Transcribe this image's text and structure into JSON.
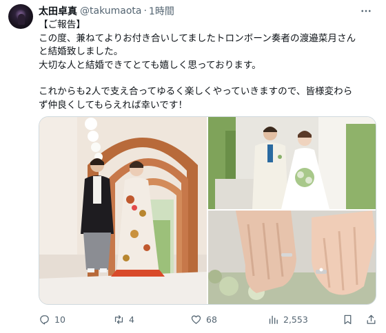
{
  "author": {
    "name": "太田卓真",
    "handle": "@takumaota",
    "separator": "·",
    "time": "1時間"
  },
  "tweet": {
    "lines": [
      "【ご報告】",
      "この度、兼ねてよりお付き合いしてましたトロンボーン奏者の渡邉菜月さん",
      "と結婚致しました。",
      "大切な人と結婚できてとても嬉しく思っております。",
      "",
      "これからも2人で支え合ってゆるく楽しくやっていきますので、皆様変わら",
      "ず仲良くしてもらえれば幸いです！"
    ]
  },
  "media": {
    "photos": [
      "couple-in-kimono-arch-corridor",
      "couple-in-western-wedding-attire",
      "hands-with-wedding-rings"
    ]
  },
  "actions": {
    "replies": "10",
    "reposts": "4",
    "likes": "68",
    "views": "2,553"
  },
  "icons": [
    "more-icon",
    "reply-icon",
    "repost-icon",
    "like-icon",
    "views-icon",
    "bookmark-icon",
    "share-icon"
  ],
  "colors": {
    "text": "#0f1419",
    "secondary": "#536471",
    "border": "#cfd9de"
  }
}
